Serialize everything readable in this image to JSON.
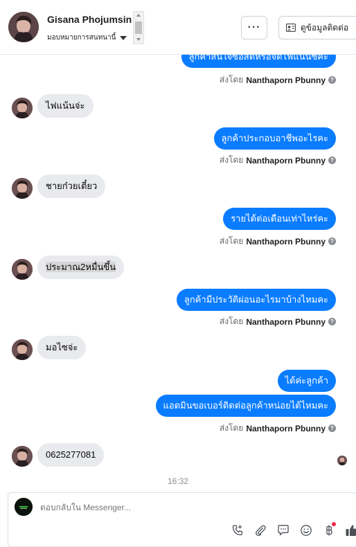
{
  "header": {
    "contact_name": "Gisana Phojumsin",
    "assign_label": "มอบหมายการสนทนานี้",
    "more_label": "···",
    "contact_button_label": "ดูข้อมูลติดต่อ"
  },
  "messages": {
    "out_1": "ลูกค้าสนใจซื้อสดหรือจัดไฟแนนซ์คะ",
    "in_1": "ไฟแน้นจ่ะ",
    "out_2": "ลูกค้าประกอบอาชีพอะไรคะ",
    "in_2": "ชายก๋วยเตี๋ยว",
    "out_3": "รายได้ต่อเดือนเท่าไหร่คะ",
    "in_3": "ประมาณ2หมื่นขึ้น",
    "out_4": "ลูกค้ามีประวัติผ่อนอะไรมาบ้างไหมคะ",
    "in_4": "มอไซจ่ะ",
    "out_5": "ได้ค่ะลูกค้า",
    "out_6": "แอดมินขอเบอร์ติดต่อลูกค้าหน่อยได้ไหมคะ",
    "in_5": "0625277081"
  },
  "sent_by": {
    "prefix": "ส่งโดย",
    "agent": "Nanthaporn Pbunny",
    "help": "?"
  },
  "timestamp": "16:32",
  "composer": {
    "placeholder": "ตอบกลับใน Messenger..."
  },
  "icons": {
    "call": "phone-add-icon",
    "attach": "paperclip-icon",
    "saved_reply": "chat-bubble-icon",
    "emoji": "smiley-icon",
    "payment": "baht-icon",
    "like": "thumbs-up-icon"
  },
  "colors": {
    "outgoing_bubble": "#0a7cff",
    "incoming_bubble": "#e9eaed",
    "notification_dot": "#f02849"
  }
}
